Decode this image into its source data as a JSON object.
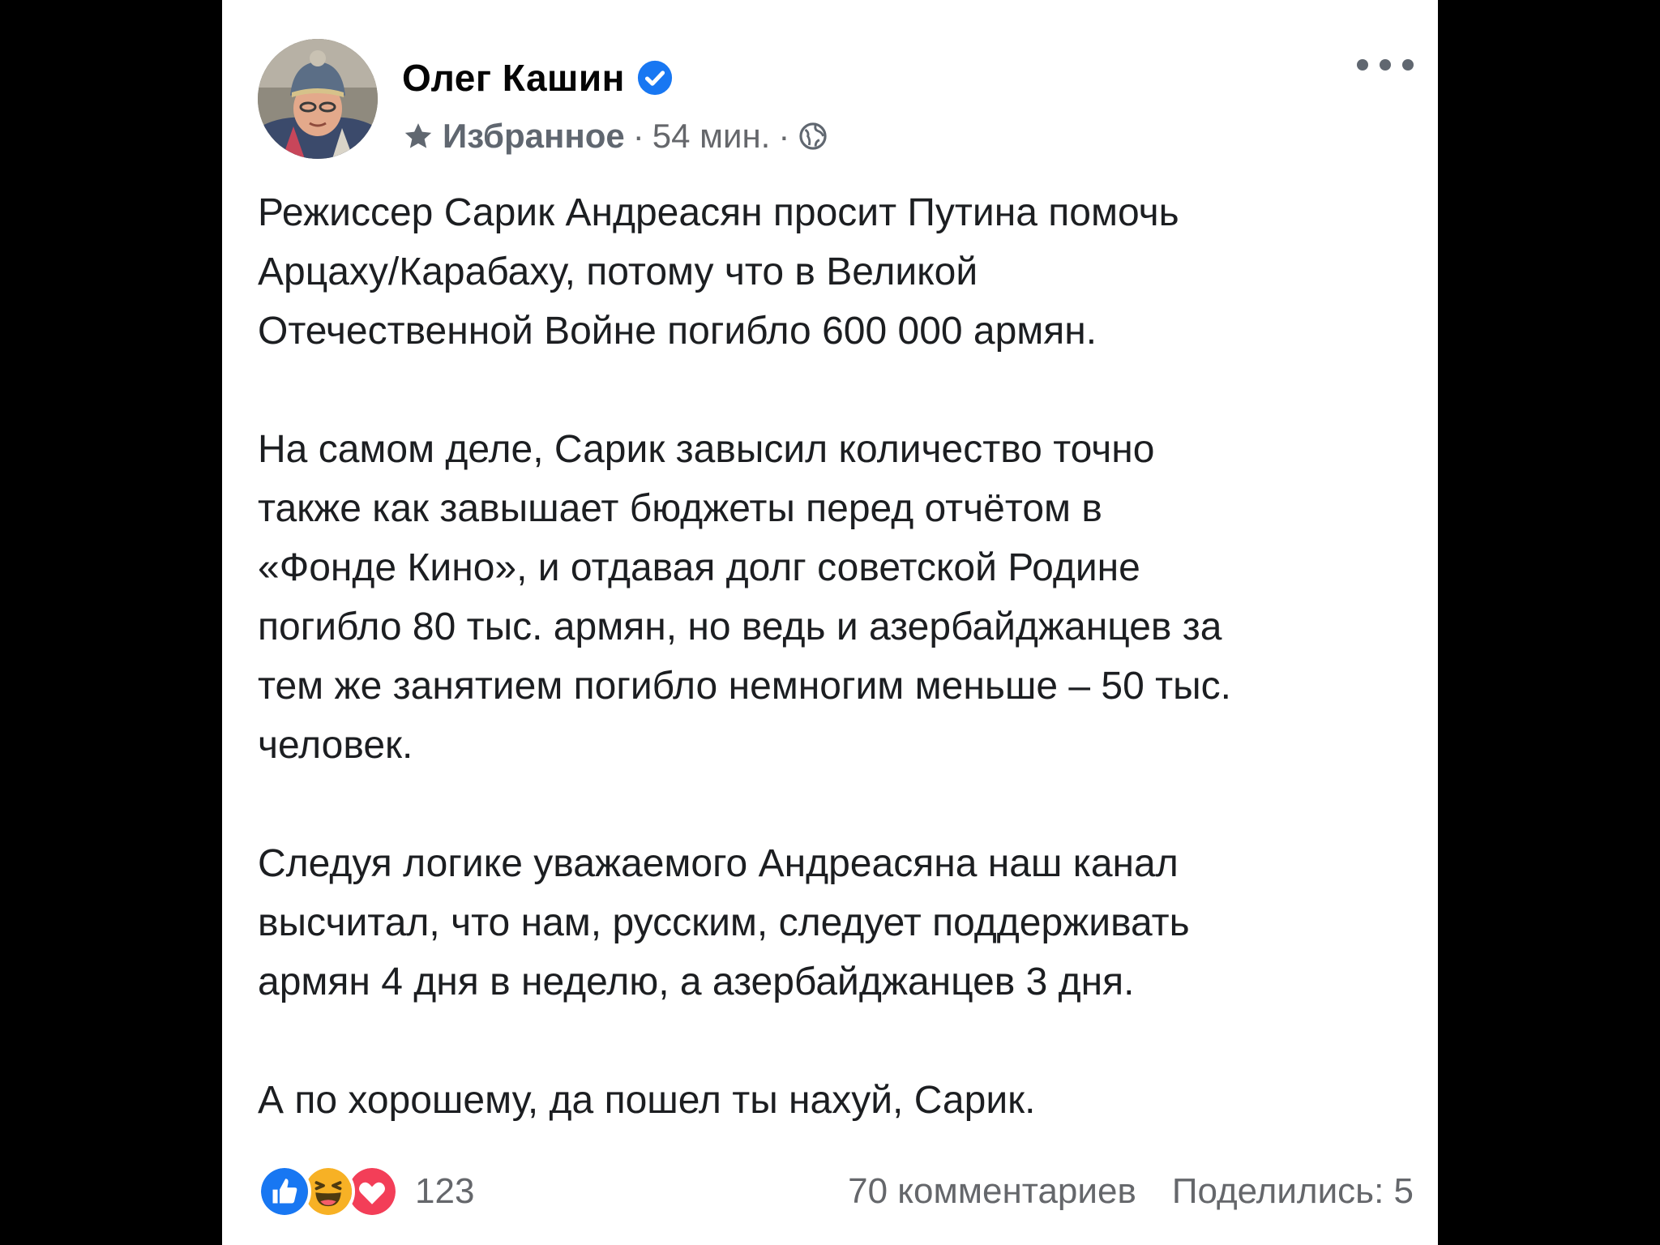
{
  "post": {
    "author_name": "Олег Кашин",
    "audience_label": "Избранное",
    "separator_1": "·",
    "time_ago": "54 мин.",
    "separator_2": "·",
    "paragraphs": [
      "Режиссер Сарик Андреасян просит Путина помочь\nАрцаху/Карабаху, потому что в Великой\nОтечественной Войне погибло 600 000 армян.",
      "На самом деле, Сарик завысил количество точно\nтакже как завышает бюджеты перед отчётом в\n«Фонде Кино», и отдавая долг советской Родине\nпогибло 80 тыс. армян, но ведь и азербайджанцев за\nтем же занятием погибло немногим меньше – 50 тыс.\nчеловек.",
      "Следуя логике уважаемого Андреасяна наш канал\nвысчитал, что нам, русским, следует поддерживать\nармян 4 дня в неделю, а азербайджанцев 3 дня.",
      "А по хорошему, да пошел ты нахуй, Сарик."
    ],
    "reactions_count": "123",
    "comments_label": "70 комментариев",
    "shares_label": "Поделились: 5"
  },
  "icons": {
    "verified": "verified-badge-icon",
    "audience": "star-icon",
    "privacy": "globe-icon",
    "more": "more-options-icon",
    "reactions": [
      "like-icon",
      "haha-icon",
      "love-icon"
    ]
  },
  "colors": {
    "facebook_blue": "#1877f2",
    "like": "#1877f2",
    "haha": "#f7b125",
    "love": "#f33e58",
    "secondary_text": "#65676b",
    "background": "#000000",
    "card": "#ffffff"
  }
}
